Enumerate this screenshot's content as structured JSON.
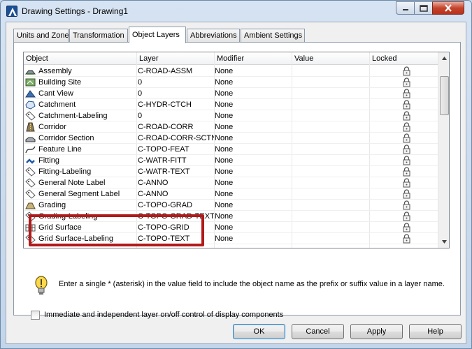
{
  "window": {
    "title": "Drawing Settings - Drawing1"
  },
  "tabs": [
    {
      "label": "Units and Zone",
      "active": false
    },
    {
      "label": "Transformation",
      "active": false
    },
    {
      "label": "Object Layers",
      "active": true
    },
    {
      "label": "Abbreviations",
      "active": false
    },
    {
      "label": "Ambient Settings",
      "active": false
    }
  ],
  "table": {
    "columns": [
      "Object",
      "Layer",
      "Modifier",
      "Value",
      "Locked"
    ],
    "rows": [
      {
        "object": "Assembly",
        "layer": "C-ROAD-ASSM",
        "modifier": "None",
        "value": "",
        "icon": "assembly-icon"
      },
      {
        "object": "Building Site",
        "layer": "0",
        "modifier": "None",
        "value": "",
        "icon": "building-site-icon"
      },
      {
        "object": "Cant View",
        "layer": "0",
        "modifier": "None",
        "value": "",
        "icon": "cant-view-icon"
      },
      {
        "object": "Catchment",
        "layer": "C-HYDR-CTCH",
        "modifier": "None",
        "value": "",
        "icon": "catchment-icon"
      },
      {
        "object": "Catchment-Labeling",
        "layer": "0",
        "modifier": "None",
        "value": "",
        "icon": "label-tag-icon"
      },
      {
        "object": "Corridor",
        "layer": "C-ROAD-CORR",
        "modifier": "None",
        "value": "",
        "icon": "corridor-icon"
      },
      {
        "object": "Corridor Section",
        "layer": "C-ROAD-CORR-SCTN",
        "modifier": "None",
        "value": "",
        "icon": "corridor-section-icon"
      },
      {
        "object": "Feature Line",
        "layer": "C-TOPO-FEAT",
        "modifier": "None",
        "value": "",
        "icon": "feature-line-icon"
      },
      {
        "object": "Fitting",
        "layer": "C-WATR-FITT",
        "modifier": "None",
        "value": "",
        "icon": "fitting-icon"
      },
      {
        "object": "Fitting-Labeling",
        "layer": "C-WATR-TEXT",
        "modifier": "None",
        "value": "",
        "icon": "label-tag-icon"
      },
      {
        "object": "General Note Label",
        "layer": "C-ANNO",
        "modifier": "None",
        "value": "",
        "icon": "label-tag-icon"
      },
      {
        "object": "General Segment Label",
        "layer": "C-ANNO",
        "modifier": "None",
        "value": "",
        "icon": "label-tag-icon"
      },
      {
        "object": "Grading",
        "layer": "C-TOPO-GRAD",
        "modifier": "None",
        "value": "",
        "icon": "grading-icon"
      },
      {
        "object": "Grading-Labeling",
        "layer": "C-TOPO-GRAD-TEXT",
        "modifier": "None",
        "value": "",
        "icon": "label-tag-icon"
      },
      {
        "object": "Grid Surface",
        "layer": "C-TOPO-GRID",
        "modifier": "None",
        "value": "",
        "icon": "grid-surface-icon"
      },
      {
        "object": "Grid Surface-Labeling",
        "layer": "C-TOPO-TEXT",
        "modifier": "None",
        "value": "",
        "icon": "label-tag-icon"
      }
    ]
  },
  "hint": {
    "text": "Enter a single * (asterisk) in the value field to include the object name as the prefix or suffix value in a layer name."
  },
  "checkbox": {
    "label": "Immediate and independent layer on/off control of display components",
    "checked": false
  },
  "buttons": {
    "ok": "OK",
    "cancel": "Cancel",
    "apply": "Apply",
    "help": "Help"
  },
  "colors": {
    "highlight_border": "#b11a1a",
    "title_bar": "#c3d5ea"
  }
}
